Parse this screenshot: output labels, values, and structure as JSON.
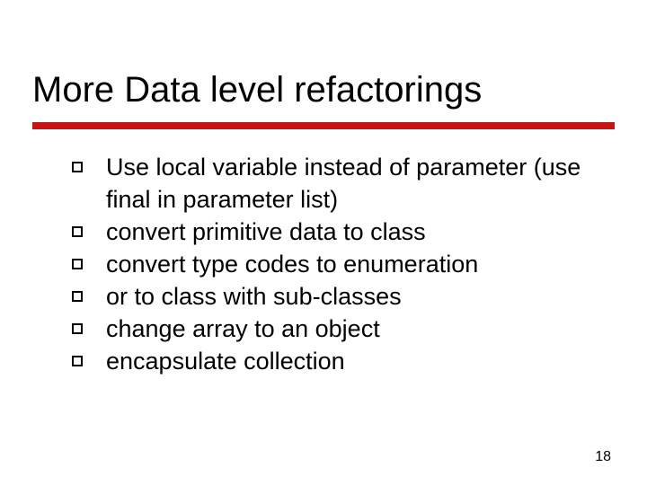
{
  "title": "More Data level refactorings",
  "bullets": [
    "Use local variable instead of parameter (use final in parameter list)",
    "convert primitive data to class",
    "convert type codes to enumeration",
    "or to class with sub-classes",
    "change array to an object",
    "encapsulate collection"
  ],
  "page_number": "18"
}
